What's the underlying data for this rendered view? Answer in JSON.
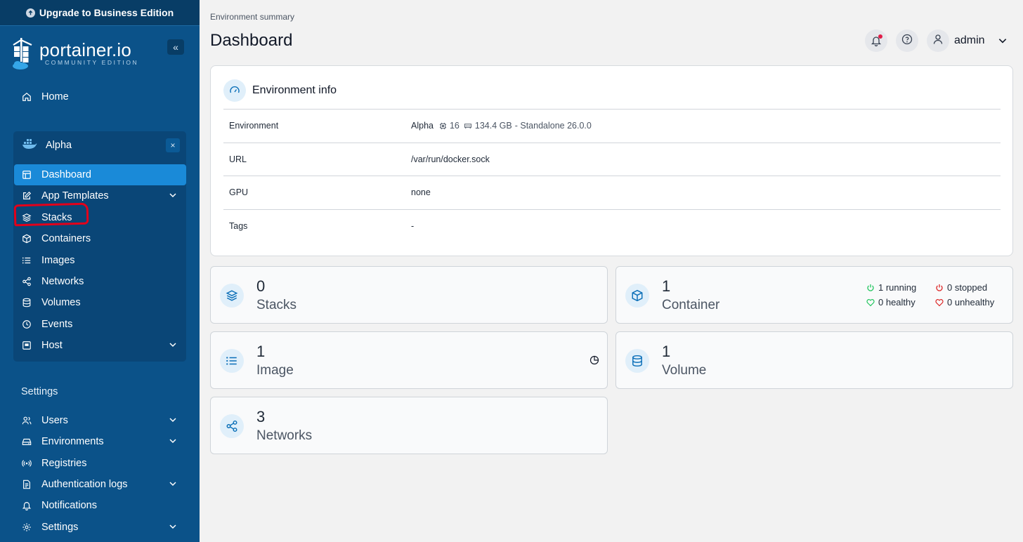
{
  "sidebar": {
    "upgrade_label": "Upgrade to Business Edition",
    "logo_text": "portainer.io",
    "logo_sub": "COMMUNITY EDITION",
    "collapse_label": "«",
    "home_label": "Home",
    "environment": {
      "name": "Alpha",
      "close_label": "×",
      "items": [
        {
          "label": "Dashboard",
          "icon": "layout-icon",
          "active": true
        },
        {
          "label": "App Templates",
          "icon": "edit-icon",
          "expandable": true
        },
        {
          "label": "Stacks",
          "icon": "layers-icon"
        },
        {
          "label": "Containers",
          "icon": "box-icon"
        },
        {
          "label": "Images",
          "icon": "list-icon"
        },
        {
          "label": "Networks",
          "icon": "share-icon"
        },
        {
          "label": "Volumes",
          "icon": "database-icon"
        },
        {
          "label": "Events",
          "icon": "clock-icon"
        },
        {
          "label": "Host",
          "icon": "host-icon",
          "expandable": true
        }
      ]
    },
    "settings_title": "Settings",
    "settings_items": [
      {
        "label": "Users",
        "icon": "users-icon",
        "expandable": true
      },
      {
        "label": "Environments",
        "icon": "hdd-icon",
        "expandable": true
      },
      {
        "label": "Registries",
        "icon": "radio-icon"
      },
      {
        "label": "Authentication logs",
        "icon": "file-icon",
        "expandable": true
      },
      {
        "label": "Notifications",
        "icon": "bell-icon"
      },
      {
        "label": "Settings",
        "icon": "gear-icon",
        "expandable": true
      }
    ]
  },
  "header": {
    "breadcrumb": "Environment summary",
    "title": "Dashboard",
    "user": "admin"
  },
  "env_info": {
    "title": "Environment info",
    "rows": [
      {
        "key": "Environment",
        "name": "Alpha",
        "cpu": "16",
        "memory": "134.4 GB",
        "suffix": "- Standalone 26.0.0"
      },
      {
        "key": "URL",
        "value": "/var/run/docker.sock"
      },
      {
        "key": "GPU",
        "value": "none"
      },
      {
        "key": "Tags",
        "value": "-"
      }
    ]
  },
  "stats": {
    "stacks": {
      "count": "0",
      "label": "Stacks"
    },
    "containers": {
      "count": "1",
      "label": "Container",
      "running": "1 running",
      "stopped": "0 stopped",
      "healthy": "0 healthy",
      "unhealthy": "0 unhealthy"
    },
    "images": {
      "count": "1",
      "label": "Image"
    },
    "volumes": {
      "count": "1",
      "label": "Volume"
    },
    "networks": {
      "count": "3",
      "label": "Networks"
    }
  },
  "colors": {
    "sidebar": "#0b5289",
    "active": "#1a8ad8",
    "accent": "#0b6fb8",
    "running": "#22c55e",
    "stopped": "#dc2626"
  }
}
